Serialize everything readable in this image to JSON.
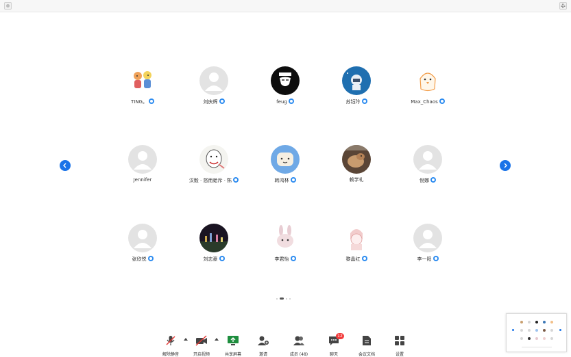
{
  "participants": [
    {
      "name": "TING。",
      "avatar": "cartoon-couple"
    },
    {
      "name": "刘庆辉",
      "avatar": "default"
    },
    {
      "name": "feug",
      "avatar": "anonymous-mask"
    },
    {
      "name": "苏钰玲",
      "avatar": "astronaut"
    },
    {
      "name": "Max_Chaos",
      "avatar": "chick"
    },
    {
      "name": "Jennifer",
      "avatar": "default"
    },
    {
      "name": "汉毅 · 怒而蛤斥 · 陈",
      "avatar": "meme-face"
    },
    {
      "name": "韩鸿林",
      "avatar": "bread-face"
    },
    {
      "name": "赖学礼",
      "avatar": "dog-photo"
    },
    {
      "name": "倪娜",
      "avatar": "default"
    },
    {
      "name": "张欣悦",
      "avatar": "default"
    },
    {
      "name": "刘志豪",
      "avatar": "night-city"
    },
    {
      "name": "李君怡",
      "avatar": "bunny"
    },
    {
      "name": "黎晶红",
      "avatar": "girl-sketch"
    },
    {
      "name": "李一阳",
      "avatar": "default"
    }
  ],
  "navigation": {
    "prev_icon": "chevron-left-icon",
    "next_icon": "chevron-right-icon",
    "page_count": 4,
    "current_page": 2
  },
  "toolbar": {
    "unmute": "解除静音",
    "start_video": "开启视频",
    "share_screen": "共享屏幕",
    "invite": "邀请",
    "participants": "成员 (48)",
    "chat": "聊天",
    "chat_badge": "12",
    "docs": "会议文档",
    "settings": "设置"
  },
  "colors": {
    "accent": "#1a73e8",
    "badge": "#2d8cf0",
    "share_green": "#1e8e3e",
    "alert_red": "#f23c3c"
  }
}
